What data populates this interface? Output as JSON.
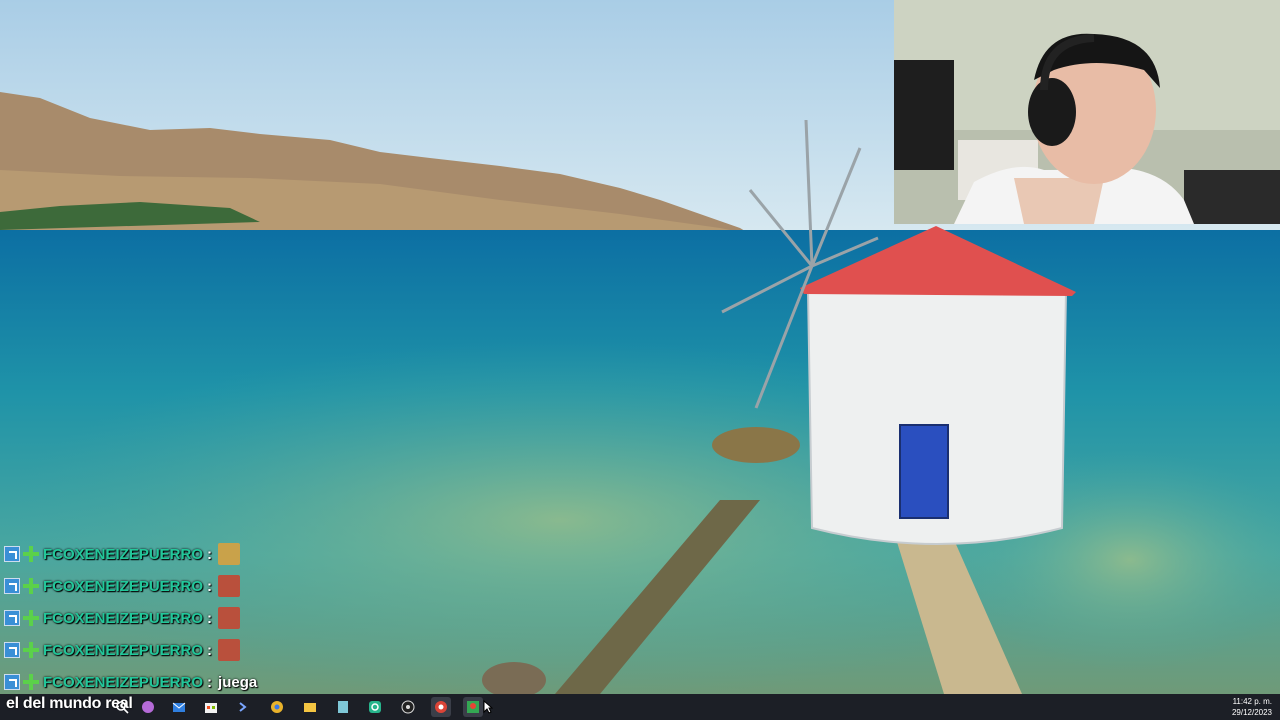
{
  "chat": {
    "messages": [
      {
        "user": "FCOXENEIZEPUERRO",
        "separator": ":",
        "text": "",
        "emote": "bird-emote"
      },
      {
        "user": "FCOXENEIZEPUERRO",
        "separator": ":",
        "text": "",
        "emote": "face-emote"
      },
      {
        "user": "FCOXENEIZEPUERRO",
        "separator": ":",
        "text": "",
        "emote": "face-emote"
      },
      {
        "user": "FCOXENEIZEPUERRO",
        "separator": ":",
        "text": "",
        "emote": "face-emote"
      },
      {
        "user": "FCOXENEIZEPUERRO",
        "separator": ":",
        "text": "juega",
        "emote": ""
      }
    ]
  },
  "caption": "el del mundo real",
  "taskbar": {
    "icons": [
      "search-icon",
      "task-view-icon",
      "copilot-icon",
      "mail-icon",
      "store-icon",
      "terminal-icon",
      "chrome-icon",
      "file-explorer-icon",
      "notepad-icon",
      "app-icon",
      "obs-icon",
      "chrome-profile-icon",
      "maps-icon"
    ]
  },
  "clock": {
    "time": "11:42 p. m.",
    "date": "29/12/2023"
  },
  "colors": {
    "chat_user": "#22c79a",
    "taskbar_bg": "#1c1f26",
    "roof": "#e0504f",
    "door": "#2a4fbf"
  }
}
